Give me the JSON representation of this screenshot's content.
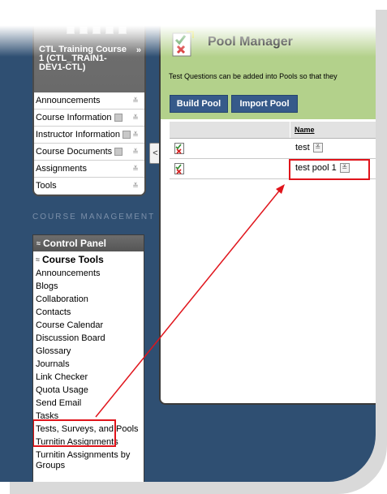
{
  "course_menu": {
    "title": "CTL Training Course 1 (CTL_TRAIN1-DEV1-CTL)",
    "items": [
      {
        "label": "Announcements",
        "has_icon": false
      },
      {
        "label": "Course Information",
        "has_icon": true
      },
      {
        "label": "Instructor Information",
        "has_icon": true
      },
      {
        "label": "Course Documents",
        "has_icon": true
      },
      {
        "label": "Assignments",
        "has_icon": false
      },
      {
        "label": "Tools",
        "has_icon": false
      }
    ]
  },
  "course_management_label": "COURSE MANAGEMENT",
  "control_panel": {
    "title": "Control Panel",
    "section": "Course Tools",
    "items": [
      "Announcements",
      "Blogs",
      "Collaboration",
      "Contacts",
      "Course Calendar",
      "Discussion Board",
      "Glossary",
      "Journals",
      "Link Checker",
      "Quota Usage",
      "Send Email",
      "Tasks",
      "Tests, Surveys, and Pools",
      "Turnitin Assignments",
      "Turnitin Assignments by Groups"
    ]
  },
  "pool_manager": {
    "title": "Pool Manager",
    "instructions": "Test Questions can be added into Pools so that they",
    "buttons": {
      "build": "Build Pool",
      "import": "Import Pool"
    },
    "column_header": "Name",
    "rows": [
      "test",
      "test pool 1"
    ]
  },
  "colors": {
    "highlight": "#e0141b",
    "header_green": "#b3d18b",
    "button_blue": "#365a8a",
    "background_blue": "#2f4f72"
  }
}
